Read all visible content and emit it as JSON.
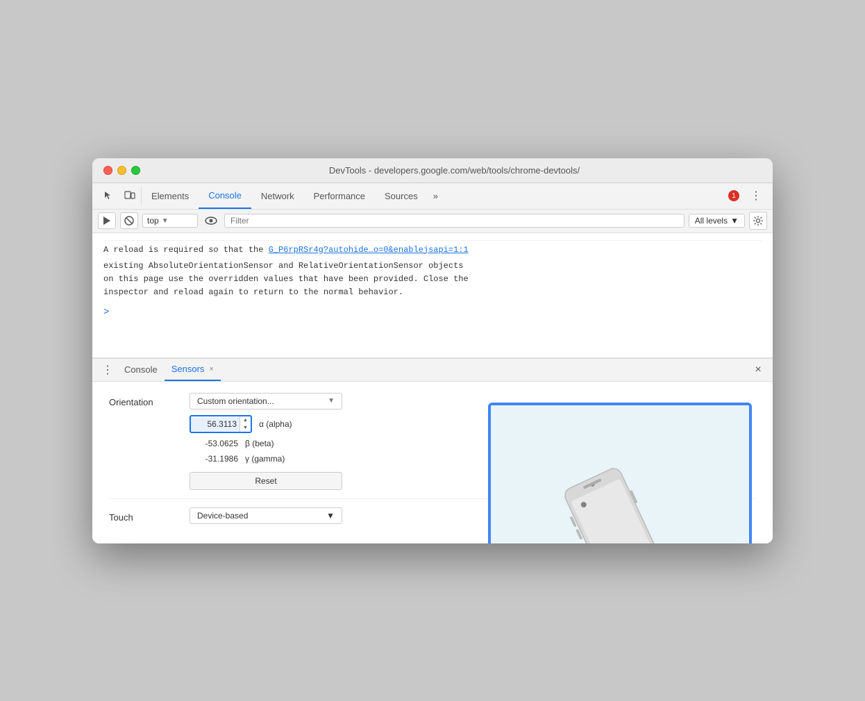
{
  "window": {
    "title": "DevTools - developers.google.com/web/tools/chrome-devtools/"
  },
  "toolbar": {
    "tabs": [
      {
        "id": "elements",
        "label": "Elements",
        "active": false
      },
      {
        "id": "console",
        "label": "Console",
        "active": true
      },
      {
        "id": "network",
        "label": "Network",
        "active": false
      },
      {
        "id": "performance",
        "label": "Performance",
        "active": false
      },
      {
        "id": "sources",
        "label": "Sources",
        "active": false
      }
    ],
    "more_label": "»",
    "error_count": "1",
    "menu_dots": "⋮"
  },
  "filter_bar": {
    "context": "top",
    "filter_placeholder": "Filter",
    "levels_label": "All levels"
  },
  "console": {
    "message": "A reload is required so that the",
    "link": "G_P6rpRSr4g?autohide…o=0&enablejsapi=1:1",
    "message2": "existing AbsoluteOrientationSensor and RelativeOrientationSensor objects",
    "message3": "on this page use the overridden values that have been provided. Close the",
    "message4": "inspector and reload again to return to the normal behavior.",
    "prompt": ">"
  },
  "bottom_toolbar": {
    "dots": "⋮",
    "tabs": [
      {
        "id": "console",
        "label": "Console",
        "active": false,
        "closable": false
      },
      {
        "id": "sensors",
        "label": "Sensors",
        "active": true,
        "closable": true
      }
    ],
    "close_icon": "×"
  },
  "sensors": {
    "orientation_label": "Orientation",
    "orientation_value": "Custom orientation...",
    "alpha_value": "56.3113",
    "alpha_label": "α (alpha)",
    "beta_value": "-53.0625",
    "beta_label": "β (beta)",
    "gamma_value": "-31.1986",
    "gamma_label": "γ (gamma)",
    "reset_label": "Reset",
    "touch_label": "Touch",
    "touch_value": "Device-based"
  }
}
